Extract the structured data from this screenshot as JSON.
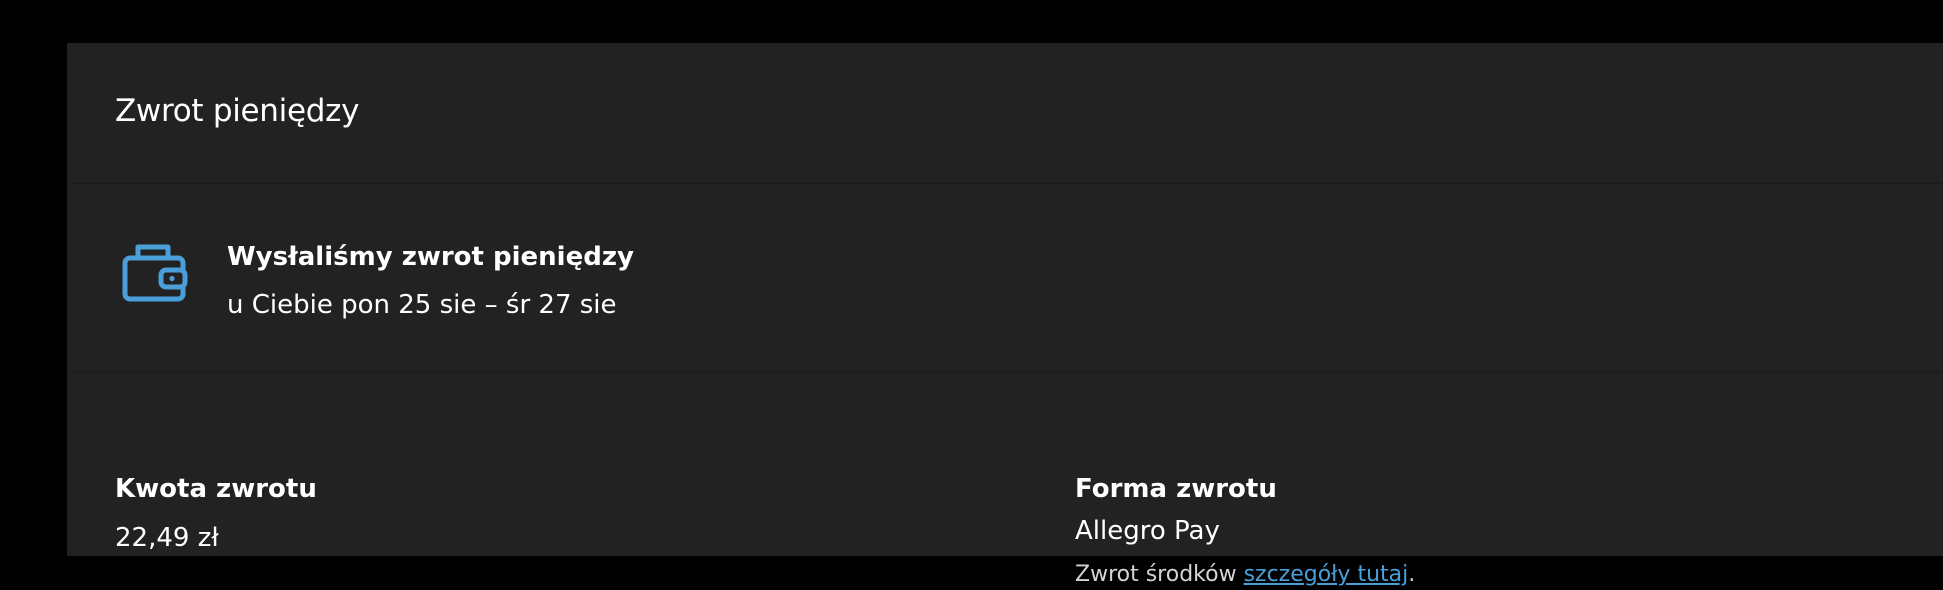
{
  "card": {
    "title": "Zwrot pieniędzy"
  },
  "status": {
    "icon": "wallet-icon",
    "icon_color": "#4a9fd8",
    "heading": "Wysłaliśmy zwrot pieniędzy",
    "date_text": "u Ciebie pon 25 sie – śr 27 sie"
  },
  "details": {
    "amount": {
      "label": "Kwota zwrotu",
      "value": "22,49 zł"
    },
    "method": {
      "label": "Forma zwrotu",
      "value": "Allegro Pay",
      "note_prefix": "Zwrot środków ",
      "link_text": "szczegóły tutaj",
      "note_suffix": "."
    }
  },
  "colors": {
    "page_background": "#000000",
    "card_background": "#222222",
    "text": "#ffffff",
    "muted_text": "#d4d4d4",
    "link": "#4a9fd8"
  }
}
